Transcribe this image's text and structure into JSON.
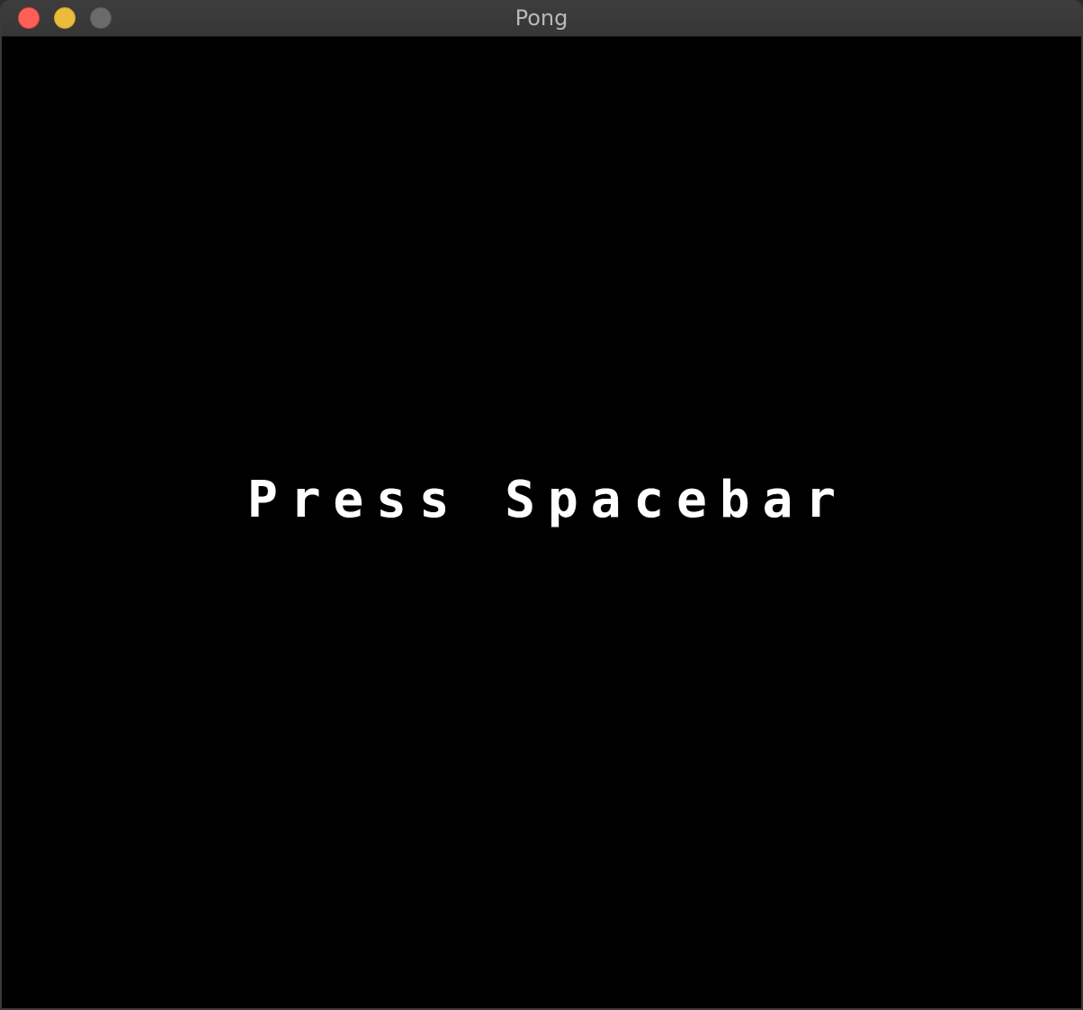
{
  "window": {
    "title": "Pong"
  },
  "game": {
    "prompt": "Press Spacebar"
  },
  "colors": {
    "close": "#ff5f57",
    "minimize": "#ebbb3c",
    "zoom": "#6b6b6b",
    "background": "#000000",
    "text": "#ffffff"
  }
}
